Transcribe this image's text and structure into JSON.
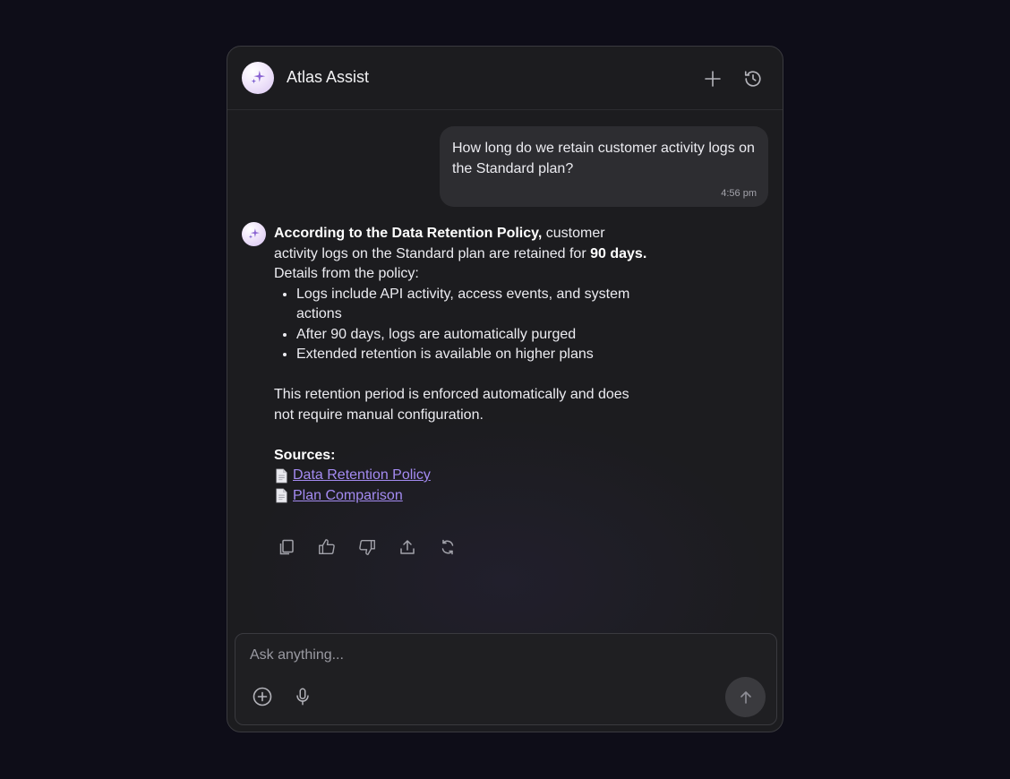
{
  "header": {
    "title": "Atlas Assist",
    "new_chat_icon": "plus-icon",
    "history_icon": "history-icon"
  },
  "user_message": {
    "text": "How long do we retain customer activity logs on the Standard plan?",
    "time": "4:56 pm"
  },
  "assistant_message": {
    "intro_bold": "According to the Data Retention Policy,",
    "intro_text": " customer activity logs on the Standard plan are retained for ",
    "intro_value": "90 days.",
    "details_heading": "Details from the policy:",
    "bullets": [
      "Logs include API activity, access events, and system actions",
      "After 90 days, logs are automatically purged",
      "Extended retention is available on higher plans"
    ],
    "closing": "This retention period is enforced automatically and does not require manual configuration.",
    "sources_label": "Sources:",
    "sources": [
      {
        "icon": "document-icon",
        "label": "Data Retention Policy"
      },
      {
        "icon": "document-icon",
        "label": "Plan Comparison"
      }
    ],
    "actions": [
      "copy-icon",
      "thumbs-up-icon",
      "thumbs-down-icon",
      "share-icon",
      "regenerate-icon"
    ]
  },
  "composer": {
    "placeholder": "Ask anything...",
    "value": "",
    "attach_icon": "plus-circle-icon",
    "mic_icon": "microphone-icon",
    "send_icon": "arrow-up-icon"
  },
  "colors": {
    "page_bg": "#0e0d18",
    "panel_bg": "#1c1c1f",
    "bubble_bg": "#2d2d31",
    "link": "#a48bf2",
    "avatar_sparkle": "#8a63d2"
  }
}
